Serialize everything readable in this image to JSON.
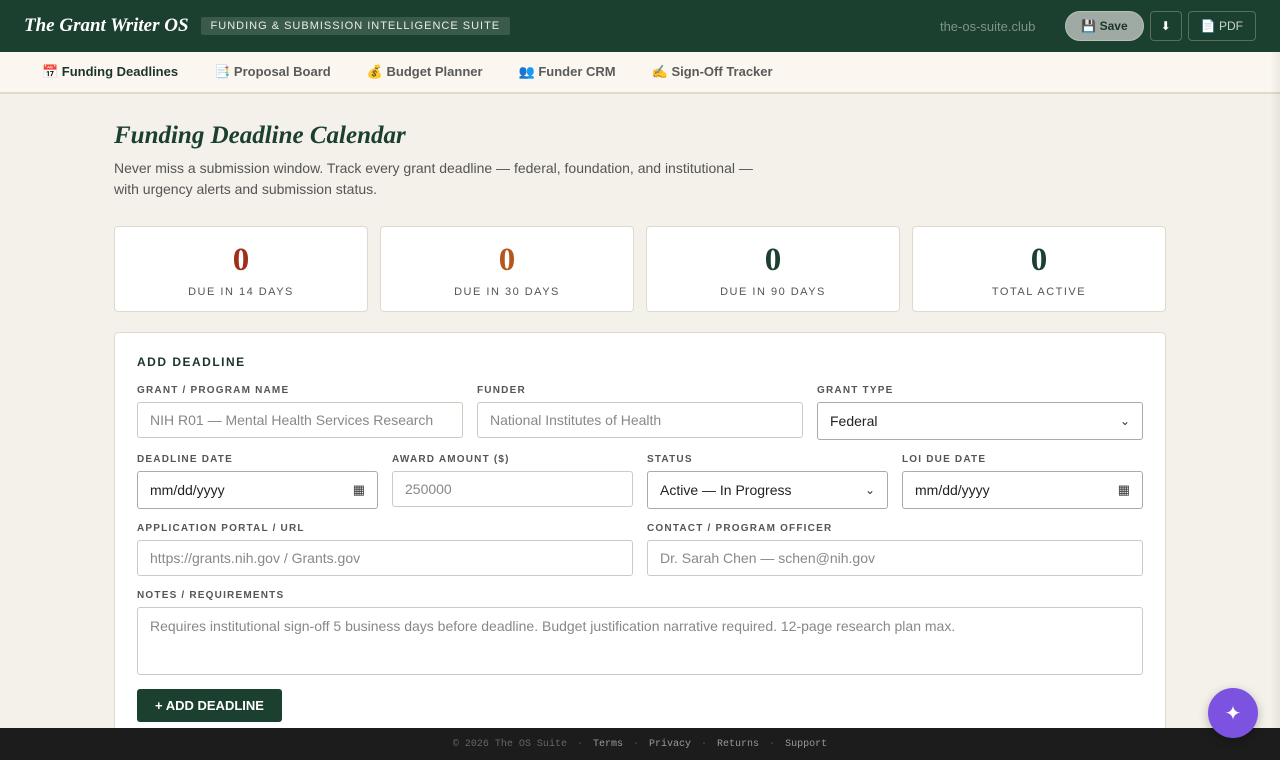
{
  "header": {
    "brand": "The Grant Writer OS",
    "suite_badge": "FUNDING & SUBMISSION INTELLIGENCE SUITE",
    "domain": "the-os-suite.club",
    "save_label": "💾 Save",
    "download_label": "⬇",
    "pdf_label": "📄 PDF"
  },
  "tabs": [
    {
      "label": "📅 Funding Deadlines",
      "active": true
    },
    {
      "label": "📑 Proposal Board"
    },
    {
      "label": "💰 Budget Planner"
    },
    {
      "label": "👥 Funder CRM"
    },
    {
      "label": "✍️ Sign-Off Tracker"
    }
  ],
  "page": {
    "title": "Funding Deadline Calendar",
    "subtitle": "Never miss a submission window. Track every grant deadline — federal, foundation, and institutional — with urgency alerts and submission status."
  },
  "stats": [
    {
      "value": "0",
      "label": "DUE IN 14 DAYS",
      "color": "#a02e1a"
    },
    {
      "value": "0",
      "label": "DUE IN 30 DAYS",
      "color": "#b5561b"
    },
    {
      "value": "0",
      "label": "DUE IN 90 DAYS",
      "color": "#1c4030"
    },
    {
      "value": "0",
      "label": "TOTAL ACTIVE",
      "color": "#1c4030"
    }
  ],
  "form": {
    "title": "ADD DEADLINE",
    "grant_name": {
      "label": "GRANT / PROGRAM NAME",
      "placeholder": "NIH R01 — Mental Health Services Research"
    },
    "funder": {
      "label": "FUNDER",
      "placeholder": "National Institutes of Health"
    },
    "grant_type": {
      "label": "GRANT TYPE",
      "value": "Federal"
    },
    "deadline_date": {
      "label": "DEADLINE DATE",
      "value": "mm/dd/yyyy"
    },
    "award_amount": {
      "label": "AWARD AMOUNT ($)",
      "placeholder": "250000"
    },
    "status": {
      "label": "STATUS",
      "value": "Active — In Progress"
    },
    "loi_date": {
      "label": "LOI DUE DATE",
      "value": "mm/dd/yyyy"
    },
    "portal": {
      "label": "APPLICATION PORTAL / URL",
      "placeholder": "https://grants.nih.gov / Grants.gov"
    },
    "contact": {
      "label": "CONTACT / PROGRAM OFFICER",
      "placeholder": "Dr. Sarah Chen — schen@nih.gov"
    },
    "notes": {
      "label": "NOTES / REQUIREMENTS",
      "placeholder": "Requires institutional sign-off 5 business days before deadline. Budget justification narrative required. 12-page research plan max."
    },
    "submit_label": "+ ADD DEADLINE"
  },
  "footer": {
    "copyright": "© 2026 The OS Suite",
    "links": [
      "Terms",
      "Privacy",
      "Returns",
      "Support"
    ]
  },
  "fab_label": "✦"
}
